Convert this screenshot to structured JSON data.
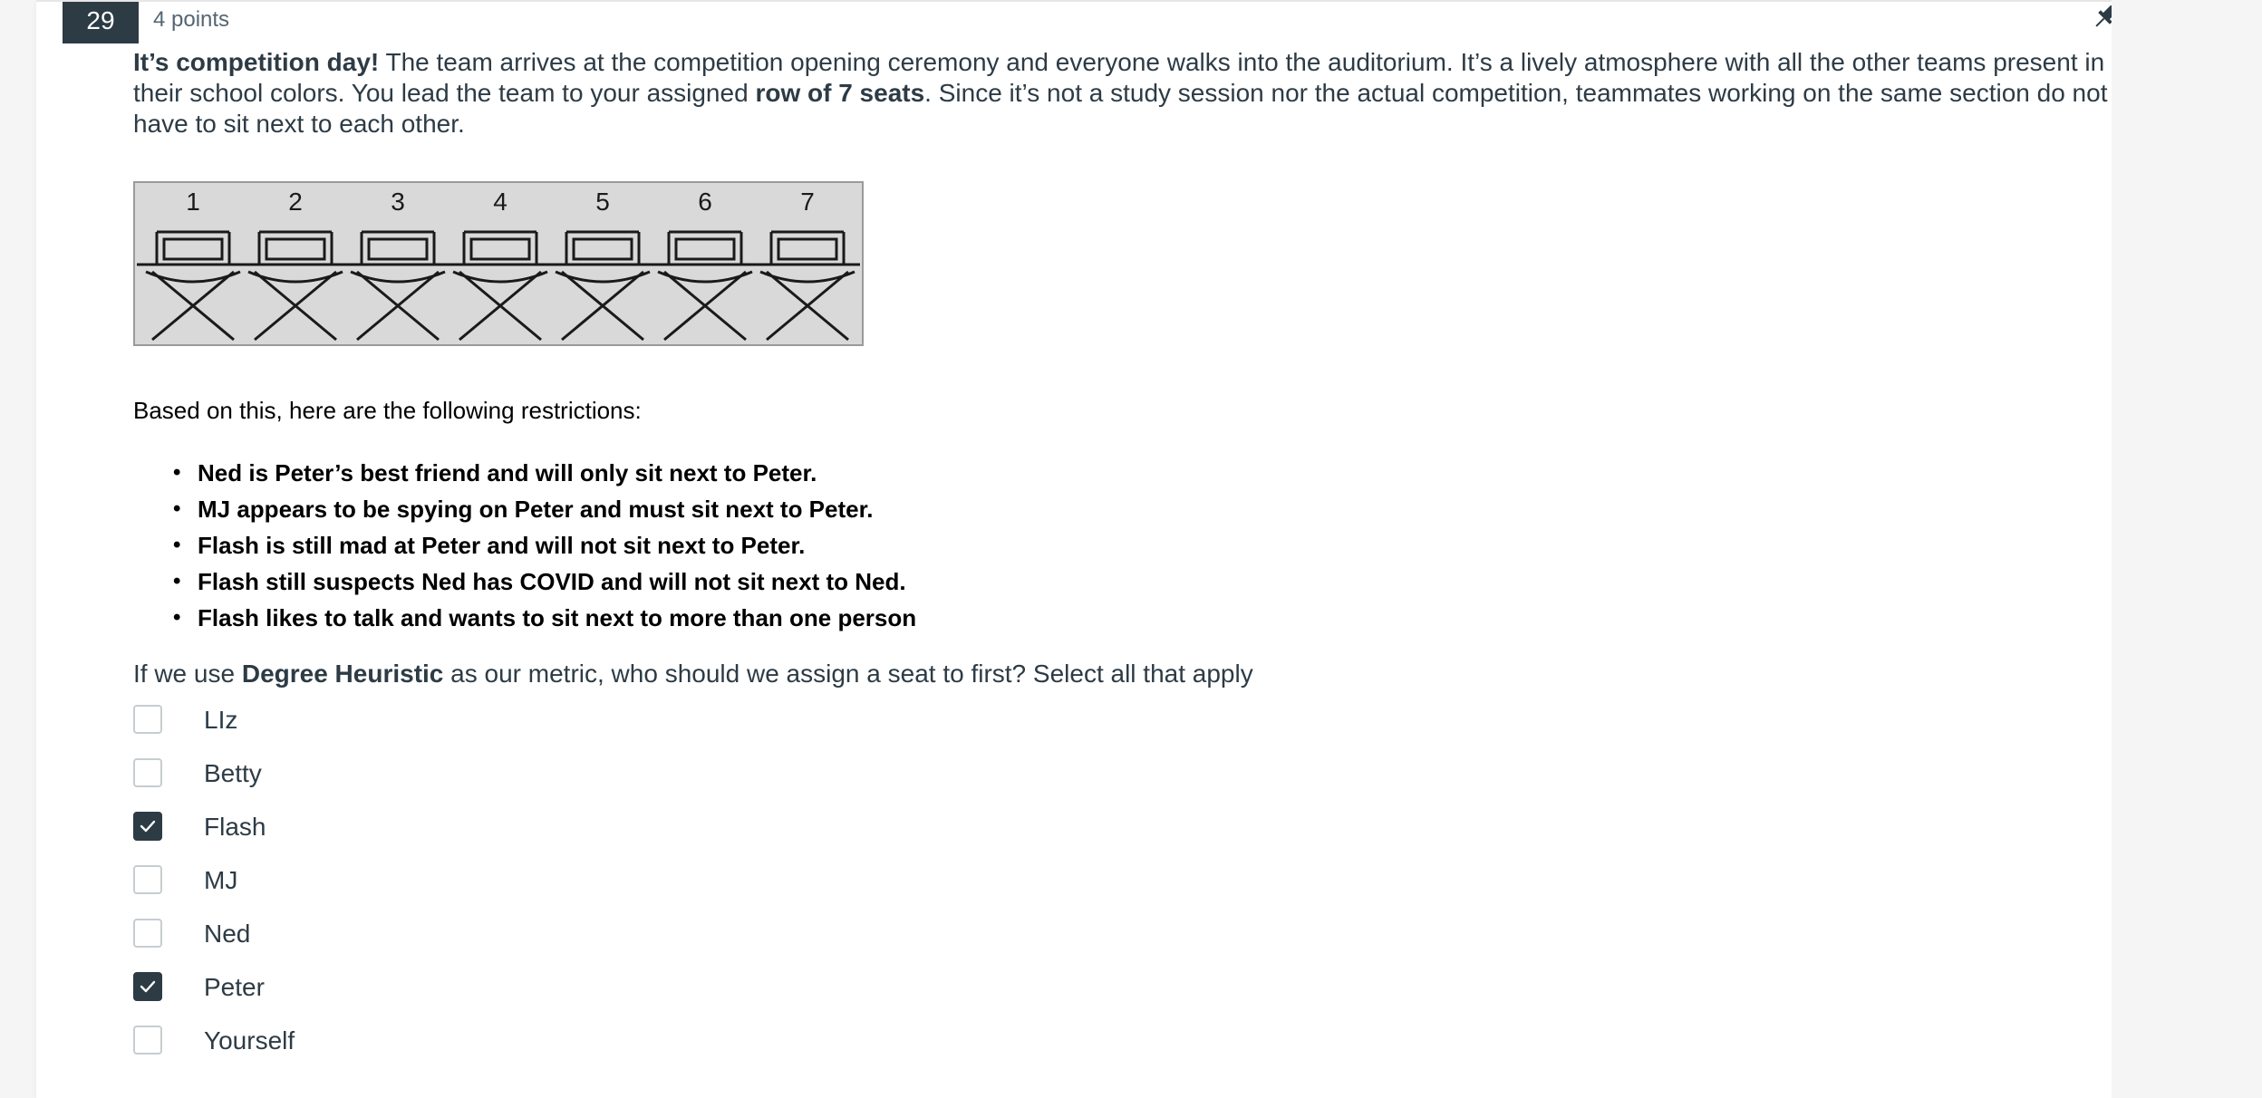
{
  "question": {
    "number": "29",
    "points": "4 points",
    "prompt_bold_1": "It’s competition day!",
    "prompt_text_1": " The team arrives at the competition opening ceremony and everyone walks into the auditorium. It’s a lively atmosphere with all the other teams present in their school colors. You lead the team to your assigned ",
    "prompt_bold_2": "row of 7 seats",
    "prompt_text_2": ". Since it’s not a study session nor the actual competition, teammates working on the same section do not have to sit next to each other."
  },
  "seat_image": {
    "seat_numbers": [
      "1",
      "2",
      "3",
      "4",
      "5",
      "6",
      "7"
    ]
  },
  "restrictions": {
    "intro": "Based on this, here are the following restrictions:",
    "items": [
      "Ned is Peter’s best friend and will only sit next to Peter.",
      "MJ appears to be spying on Peter and must sit next to Peter.",
      "Flash is still mad at Peter and will not sit next to Peter.",
      "Flash still suspects Ned has COVID and will not sit next to Ned.",
      "Flash likes to talk and wants to sit next to more than one person"
    ]
  },
  "prompt_question": {
    "text_before": "If we use ",
    "bold": "Degree Heuristic",
    "text_after": " as our metric, who should we assign a seat to first? Select all that apply"
  },
  "answers": [
    {
      "label": "LIz",
      "checked": false
    },
    {
      "label": "Betty",
      "checked": false
    },
    {
      "label": "Flash",
      "checked": true
    },
    {
      "label": "MJ",
      "checked": false
    },
    {
      "label": "Ned",
      "checked": false
    },
    {
      "label": "Peter",
      "checked": true
    },
    {
      "label": "Yourself",
      "checked": false
    }
  ],
  "icons": {
    "pin": "pin-icon",
    "check": "check-icon"
  },
  "colors": {
    "header_bg": "#2d3b45",
    "text": "#2d3b45",
    "checkbox_checked": "#2d3b45",
    "checkbox_border": "#c7cdd1",
    "seat_image_bg": "#d9d9d9"
  }
}
